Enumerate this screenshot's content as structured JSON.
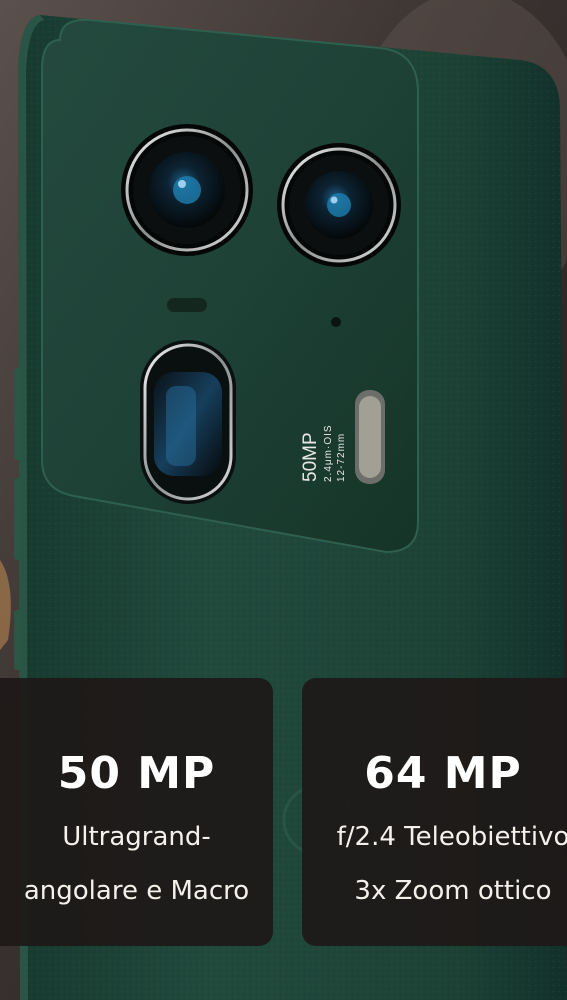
{
  "colors": {
    "phone_green": "#20463a",
    "card_background": "#1e1918",
    "text": "#ffffff"
  },
  "camera_module": {
    "main_sensor_label": "50MP",
    "sensor_detail_line1": "2.4μm·OIS",
    "sensor_detail_line2": "12-72mm"
  },
  "specs": [
    {
      "value": "50 MP",
      "line1": "Ultragrand-",
      "line2": "angolare e Macro"
    },
    {
      "value": "64 MP",
      "line1": "f/2.4 Teleobiettivo",
      "line2": "3x Zoom ottico"
    }
  ]
}
